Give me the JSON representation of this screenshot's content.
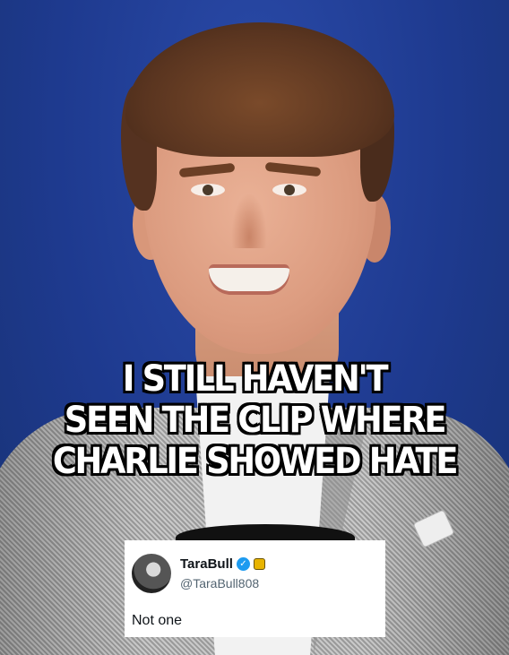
{
  "meme": {
    "caption_lines": [
      "I STILL HAVEN'T",
      "SEEN THE CLIP WHERE",
      "CHARLIE SHOWED HATE"
    ]
  },
  "post": {
    "display_name": "TaraBull",
    "handle": "@TaraBull808",
    "text": "Not one",
    "verified_icon": "verified-check-icon",
    "affiliation_icon": "affiliation-badge-icon",
    "colors": {
      "verified": "#1d9bf0",
      "affiliation": "#e8b400",
      "background": "#1e3a8f"
    }
  }
}
